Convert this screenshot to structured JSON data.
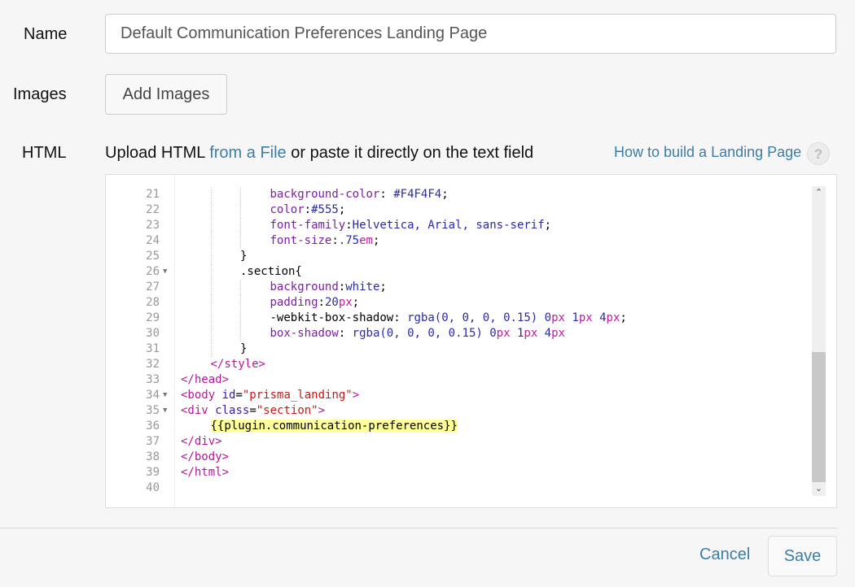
{
  "form": {
    "name_label": "Name",
    "name_value": "Default Communication Preferences Landing Page",
    "images_label": "Images",
    "add_images_label": "Add Images",
    "html_label": "HTML",
    "upload_prefix": "Upload HTML ",
    "upload_link": "from a File",
    "upload_suffix": " or paste it directly on the text field",
    "howto_link": "How to build a Landing Page",
    "help_icon": "?",
    "cancel_label": "Cancel",
    "save_label": "Save"
  },
  "editor": {
    "scroll_up_icon": "⌃",
    "scroll_down_icon": "⌄",
    "lines": [
      {
        "n": "21",
        "fold": false,
        "indent": 3,
        "tokens": [
          [
            "t-prop",
            "background-color"
          ],
          [
            "t-plain",
            ": "
          ],
          [
            "t-val",
            "#F4F4F4"
          ],
          [
            "t-plain",
            ";"
          ]
        ]
      },
      {
        "n": "22",
        "fold": false,
        "indent": 3,
        "tokens": [
          [
            "t-prop",
            "color"
          ],
          [
            "t-plain",
            ":"
          ],
          [
            "t-val",
            "#555"
          ],
          [
            "t-plain",
            ";"
          ]
        ]
      },
      {
        "n": "23",
        "fold": false,
        "indent": 3,
        "tokens": [
          [
            "t-prop",
            "font-family"
          ],
          [
            "t-plain",
            ":"
          ],
          [
            "t-val",
            "Helvetica, Arial, sans-serif"
          ],
          [
            "t-plain",
            ";"
          ]
        ]
      },
      {
        "n": "24",
        "fold": false,
        "indent": 3,
        "tokens": [
          [
            "t-prop",
            "font-size"
          ],
          [
            "t-plain",
            ":"
          ],
          [
            "t-val",
            ".75"
          ],
          [
            "t-unit",
            "em"
          ],
          [
            "t-plain",
            ";"
          ]
        ]
      },
      {
        "n": "25",
        "fold": false,
        "indent": 2,
        "tokens": [
          [
            "t-plain",
            "}"
          ]
        ]
      },
      {
        "n": "26",
        "fold": true,
        "indent": 2,
        "tokens": [
          [
            "t-plain",
            ".section{"
          ]
        ]
      },
      {
        "n": "27",
        "fold": false,
        "indent": 3,
        "tokens": [
          [
            "t-prop",
            "background"
          ],
          [
            "t-plain",
            ":"
          ],
          [
            "t-val",
            "white"
          ],
          [
            "t-plain",
            ";"
          ]
        ]
      },
      {
        "n": "28",
        "fold": false,
        "indent": 3,
        "tokens": [
          [
            "t-prop",
            "padding"
          ],
          [
            "t-plain",
            ":"
          ],
          [
            "t-val",
            "20"
          ],
          [
            "t-unit",
            "px"
          ],
          [
            "t-plain",
            ";"
          ]
        ]
      },
      {
        "n": "29",
        "fold": false,
        "indent": 3,
        "tokens": [
          [
            "t-plain",
            "-webkit-box-shadow: "
          ],
          [
            "t-val",
            "rgba(0, 0, 0, 0.15) 0"
          ],
          [
            "t-unit",
            "px"
          ],
          [
            "t-val",
            " 1"
          ],
          [
            "t-unit",
            "px"
          ],
          [
            "t-val",
            " 4"
          ],
          [
            "t-unit",
            "px"
          ],
          [
            "t-plain",
            ";"
          ]
        ]
      },
      {
        "n": "30",
        "fold": false,
        "indent": 3,
        "tokens": [
          [
            "t-prop",
            "box-shadow"
          ],
          [
            "t-plain",
            ": "
          ],
          [
            "t-val",
            "rgba(0, 0, 0, 0.15) 0"
          ],
          [
            "t-unit",
            "px"
          ],
          [
            "t-val",
            " 1"
          ],
          [
            "t-unit",
            "px"
          ],
          [
            "t-val",
            " 4"
          ],
          [
            "t-unit",
            "px"
          ]
        ]
      },
      {
        "n": "31",
        "fold": false,
        "indent": 2,
        "tokens": [
          [
            "t-plain",
            "}"
          ]
        ]
      },
      {
        "n": "32",
        "fold": false,
        "indent": 1,
        "tokens": [
          [
            "t-tag",
            "</style>"
          ]
        ]
      },
      {
        "n": "33",
        "fold": false,
        "indent": 0,
        "tokens": [
          [
            "t-tag",
            "</head>"
          ]
        ]
      },
      {
        "n": "34",
        "fold": true,
        "indent": 0,
        "tokens": [
          [
            "t-tag",
            "<body "
          ],
          [
            "t-attr",
            "id"
          ],
          [
            "t-plain",
            "="
          ],
          [
            "t-str",
            "\"prisma_landing\""
          ],
          [
            "t-tag",
            ">"
          ]
        ]
      },
      {
        "n": "35",
        "fold": true,
        "indent": 0,
        "tokens": [
          [
            "t-tag",
            "<div "
          ],
          [
            "t-attr",
            "class"
          ],
          [
            "t-plain",
            "="
          ],
          [
            "t-str",
            "\"section\""
          ],
          [
            "t-tag",
            ">"
          ]
        ]
      },
      {
        "n": "36",
        "fold": false,
        "indent": 1,
        "tokens": [
          [
            "t-plain hl",
            "{{plugin.communication-preferences}}"
          ]
        ]
      },
      {
        "n": "37",
        "fold": false,
        "indent": 0,
        "tokens": [
          [
            "t-tag",
            "</div>"
          ]
        ]
      },
      {
        "n": "38",
        "fold": false,
        "indent": 0,
        "tokens": [
          [
            "t-tag",
            "</body>"
          ]
        ]
      },
      {
        "n": "39",
        "fold": false,
        "indent": 0,
        "tokens": [
          [
            "t-tag",
            "</html>"
          ]
        ]
      },
      {
        "n": "40",
        "fold": false,
        "indent": 0,
        "tokens": []
      }
    ]
  }
}
